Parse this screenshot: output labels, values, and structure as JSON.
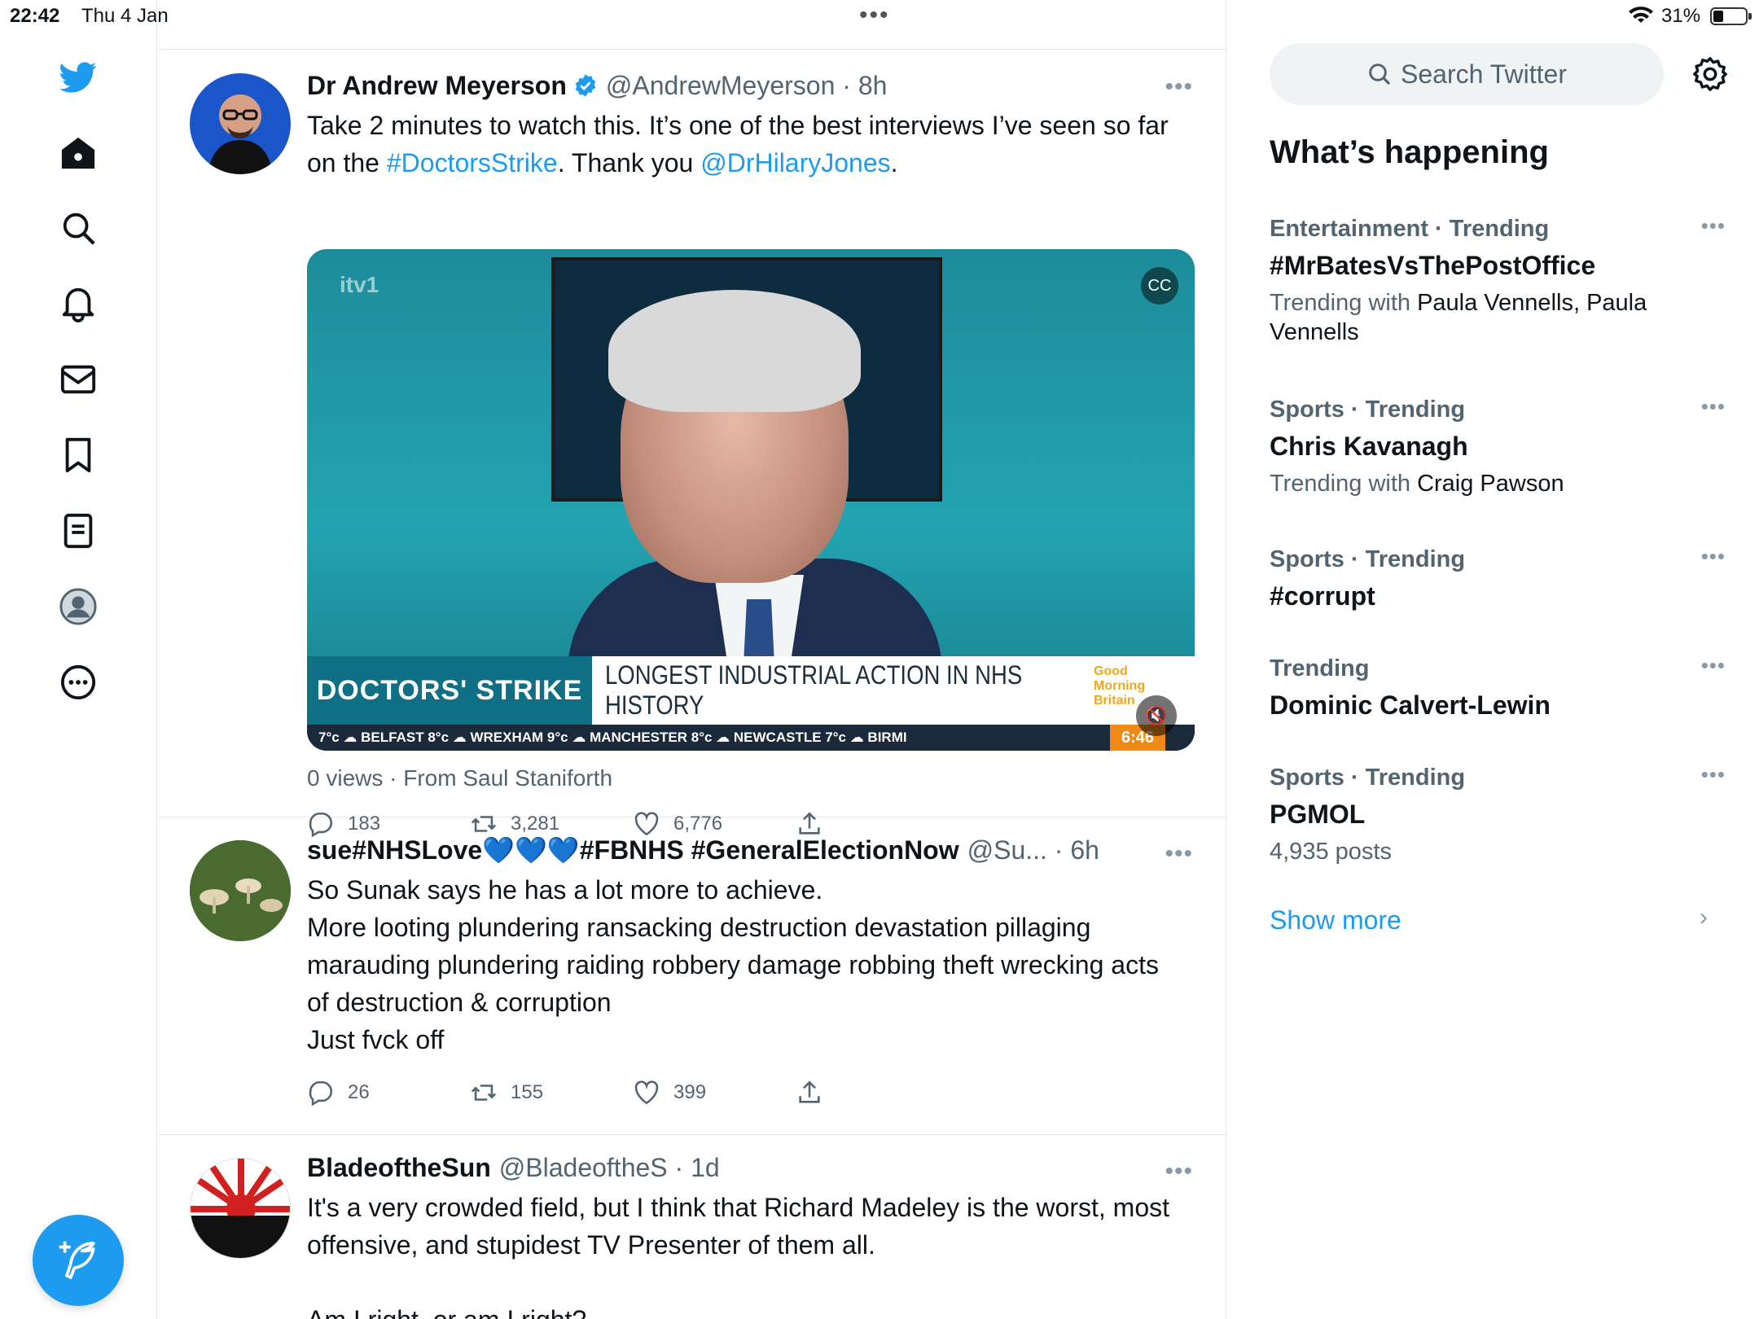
{
  "status_bar": {
    "time": "22:42",
    "date": "Thu 4 Jan",
    "battery": "31%"
  },
  "tweets": [
    {
      "name": "Dr Andrew Meyerson",
      "handle_time": "@AndrewMeyerson · 8h",
      "text_a": "Take 2 minutes to watch this. It’s one of the best interviews I’ve seen so far on the ",
      "hashtag": "#DoctorsStrike",
      "text_b": ". Thank you ",
      "mention": "@DrHilaryJones",
      "text_c": ".",
      "media": {
        "channel_logo": "itv1",
        "strap_label": "DOCTORS' STRIKE",
        "strap_headline": "LONGEST INDUSTRIAL ACTION IN NHS HISTORY",
        "show_logo": "Good Morning Britain",
        "ticker": "7°c   ☁ BELFAST 8°c   ☁ WREXHAM 9°c   ☁ MANCHESTER 8°c   ☁ NEWCASTLE 7°c   ☁ BIRMI",
        "clock": "6:46"
      },
      "views": "0 views · From Saul Staniforth",
      "replies": "183",
      "retweets": "3,281",
      "likes": "6,776"
    },
    {
      "name": "sue#NHSLove💙💙💙#FBNHS #GeneralElectionNow",
      "handle_time": "@Su... · 6h",
      "text": "So Sunak says he has a lot more to achieve.\nMore looting plundering ransacking destruction devastation pillaging marauding plundering raiding   robbery damage robbing theft wrecking acts of destruction & corruption\nJust fvck off",
      "replies": "26",
      "retweets": "155",
      "likes": "399"
    },
    {
      "name": "BladeoftheSun",
      "handle_time": "@BladeoftheS · 1d",
      "text": "It's a very crowded field, but I think that Richard Madeley is the worst, most offensive, and stupidest TV Presenter of them all.\n\nAm I right, or am I right?"
    }
  ],
  "sidebar": {
    "search_placeholder": "Search Twitter",
    "heading": "What’s happening",
    "trends": [
      {
        "meta": "Entertainment · Trending",
        "title": "#MrBatesVsThePostOffice",
        "sub_grey": "Trending with ",
        "sub": "Paula Vennells, Paula Vennells"
      },
      {
        "meta": "Sports · Trending",
        "title": "Chris Kavanagh",
        "sub_grey": "Trending with ",
        "sub": "Craig Pawson"
      },
      {
        "meta": "Sports · Trending",
        "title": "#corrupt"
      },
      {
        "meta": "Trending",
        "title": "Dominic Calvert-Lewin"
      },
      {
        "meta": "Sports · Trending",
        "title": "PGMOL",
        "sub_grey": "4,935 posts"
      }
    ],
    "show_more": "Show more"
  },
  "colors": {
    "accent": "#1d9bf0",
    "secondary_text": "#536471"
  }
}
